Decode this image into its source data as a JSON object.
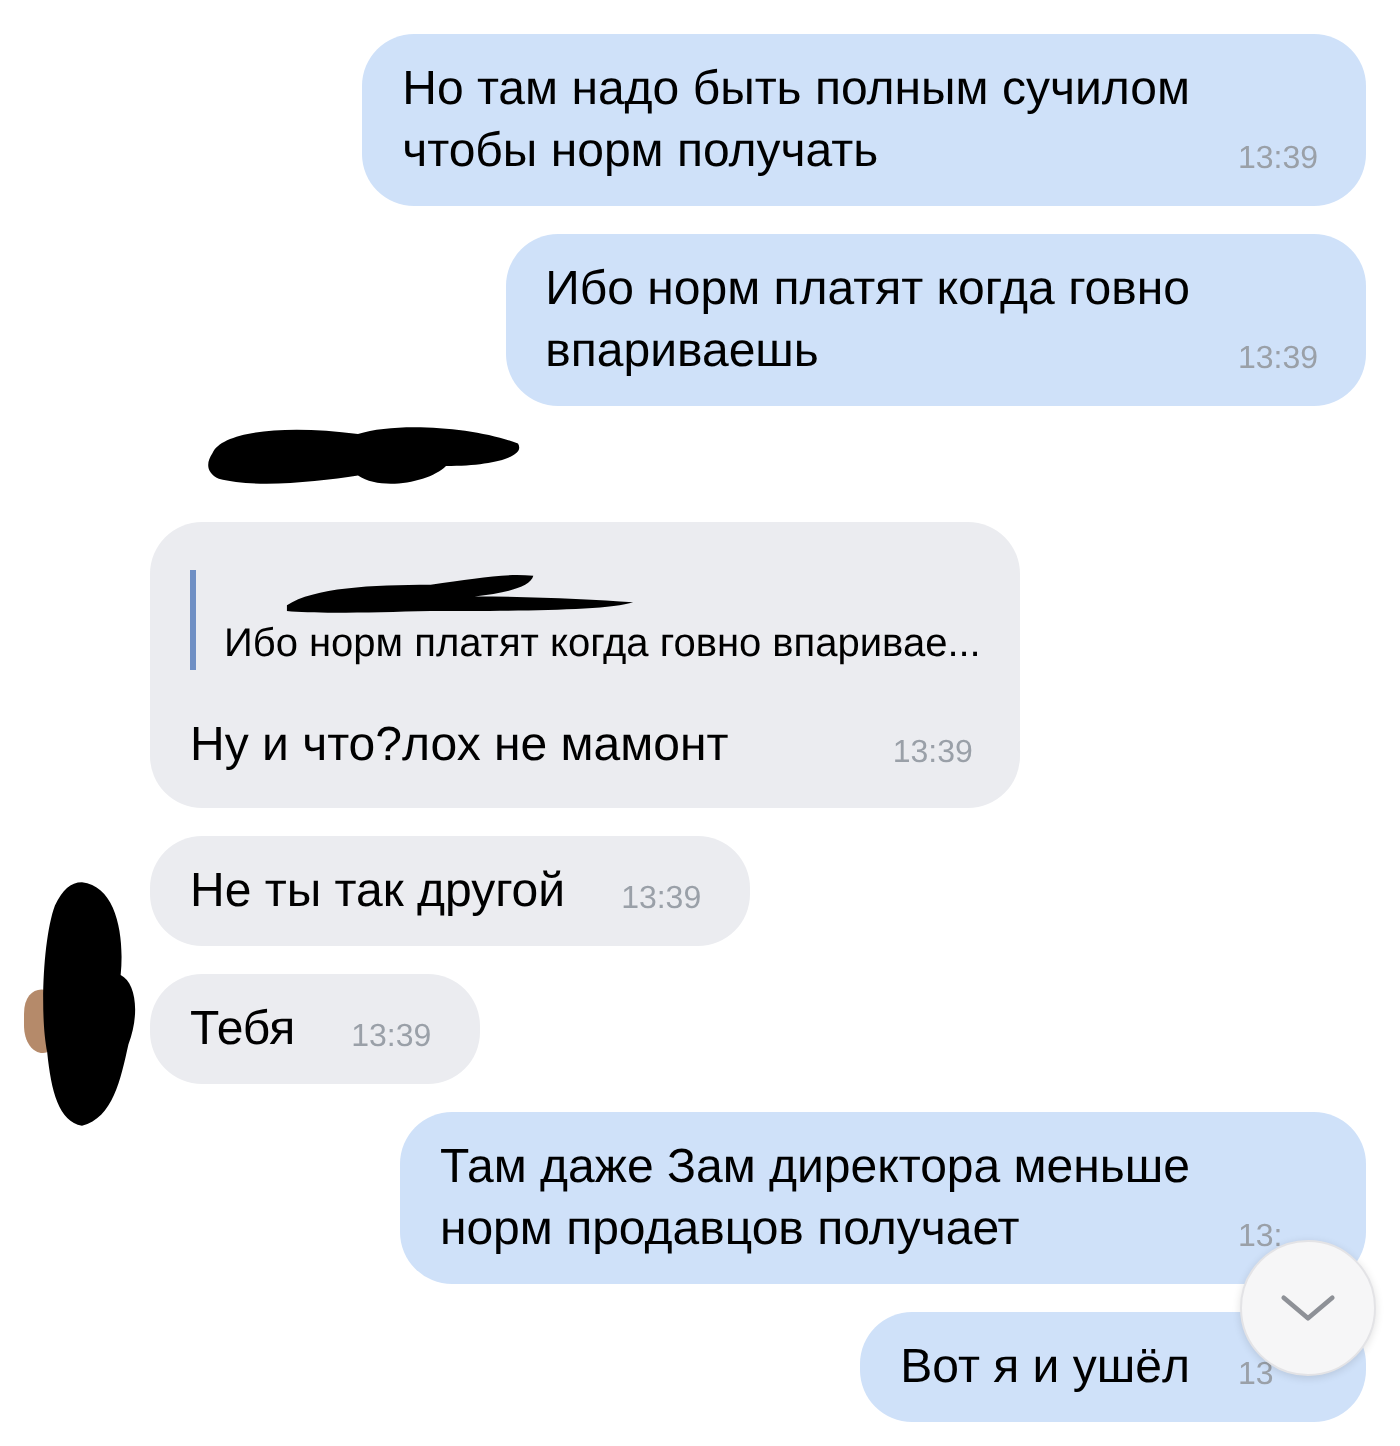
{
  "messages": [
    {
      "kind": "out",
      "text": "Но там надо быть полным сучилом\nчтобы норм получать",
      "time": "13:39"
    },
    {
      "kind": "out",
      "text": "Ибо норм платят когда говно\nвпариваешь",
      "time": "13:39"
    },
    {
      "kind": "in",
      "quote": {
        "text": "Ибо норм платят когда говно впаривае..."
      },
      "text": "Ну и что?лох не мамонт",
      "time": "13:39"
    },
    {
      "kind": "in",
      "text": "Не ты так другой",
      "time": "13:39"
    },
    {
      "kind": "in",
      "avatar": true,
      "text": "Тебя",
      "time": "13:39"
    },
    {
      "kind": "out",
      "text": "Там даже Зам директора меньше\nнорм продавцов получает",
      "time": "13:"
    },
    {
      "kind": "out",
      "text": "Вот я и ушёл",
      "time": "13"
    }
  ]
}
